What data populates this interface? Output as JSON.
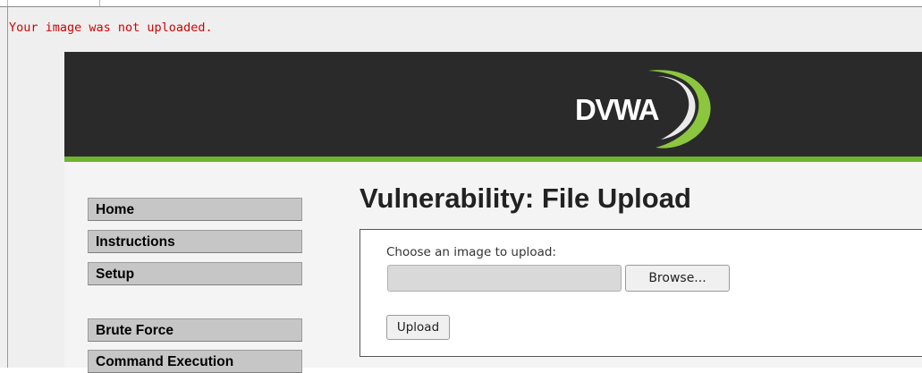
{
  "error_message": "Your image was not uploaded.",
  "logo": {
    "text": "DVWA"
  },
  "menu": {
    "items": [
      {
        "label": "Home"
      },
      {
        "label": "Instructions"
      },
      {
        "label": "Setup"
      },
      {
        "label": "Brute Force"
      },
      {
        "label": "Command Execution"
      }
    ]
  },
  "main": {
    "title": "Vulnerability: File Upload",
    "form": {
      "choose_label": "Choose an image to upload:",
      "file_value": "",
      "browse_label": "Browse...",
      "upload_label": "Upload"
    }
  },
  "colors": {
    "header_background": "#2a2a2a",
    "header_stripe": "#6fb32f",
    "error_text": "#d40000",
    "menu_item_background": "#c6c6c6"
  }
}
